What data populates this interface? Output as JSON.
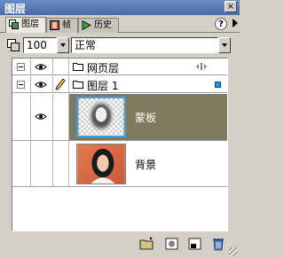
{
  "window": {
    "title": "图层",
    "close_label": "×"
  },
  "tabs": [
    {
      "label": "图层",
      "active": true
    },
    {
      "label": "帧",
      "active": false
    },
    {
      "label": "历史",
      "active": false
    }
  ],
  "tab_help": "?",
  "controls": {
    "opacity_value": "100",
    "blend_mode": "正常"
  },
  "layers": {
    "web_layer": {
      "label": "网页层"
    },
    "layer1": {
      "label": "图层 1"
    },
    "sub_items": [
      {
        "label": "蒙板",
        "selected": true
      },
      {
        "label": "背景",
        "selected": false
      }
    ]
  },
  "colors": {
    "titlebar": "#5a7ab6",
    "selected_row": "#7f7a5f",
    "layer_marker": "#1e90ff"
  }
}
